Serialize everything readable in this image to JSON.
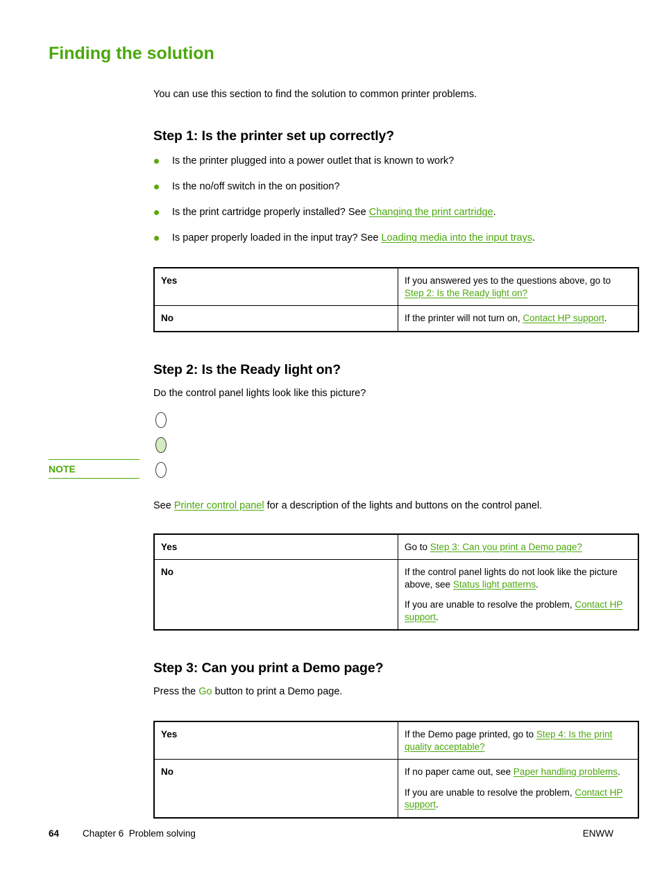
{
  "document": {
    "title": "Finding the solution",
    "intro": "You can use this section to find the solution to common printer problems."
  },
  "step1": {
    "heading": "Step 1: Is the printer set up correctly?",
    "bullets": [
      {
        "text_before": "Is the printer plugged into a power outlet that is known to work?",
        "link": "",
        "text_after": ""
      },
      {
        "text_before": "Is the no/off switch in the on position?",
        "link": "",
        "text_after": ""
      },
      {
        "text_before": "Is the print cartridge properly installed? See ",
        "link": "Changing the print cartridge",
        "text_after": "."
      },
      {
        "text_before": "Is paper properly loaded in the input tray? See ",
        "link": "Loading media into the input trays",
        "text_after": "."
      }
    ],
    "table": {
      "yes_label": "Yes",
      "no_label": "No",
      "yes_text_before": "If you answered yes to the questions above, go to ",
      "yes_link": "Step 2: Is the Ready light on?",
      "yes_text_after": "",
      "no_text_before": "If the printer will not turn on, ",
      "no_link": "Contact HP support",
      "no_text_after": "."
    }
  },
  "step2": {
    "heading": "Step 2: Is the Ready light on?",
    "question": "Do the control panel lights look like this picture?",
    "lights": [
      {
        "name": "attention-light",
        "state": "off"
      },
      {
        "name": "ready-light",
        "state": "on"
      },
      {
        "name": "go-light",
        "state": "off"
      }
    ],
    "note": {
      "label": "NOTE",
      "text_before": "See ",
      "link": "Printer control panel",
      "text_after": " for a description of the lights and buttons on the control panel."
    },
    "table": {
      "yes_label": "Yes",
      "no_label": "No",
      "yes_text_before": "Go to ",
      "yes_link": "Step 3: Can you print a Demo page?",
      "yes_text_after": "",
      "no_p1_before": "If the control panel lights do not look like the picture above, see ",
      "no_p1_link": "Status light patterns",
      "no_p1_after": ".",
      "no_p2_before": "If you are unable to resolve the problem, ",
      "no_p2_link": "Contact HP support",
      "no_p2_after": "."
    }
  },
  "step3": {
    "heading": "Step 3: Can you print a Demo page?",
    "instruction_before": "Press the ",
    "instruction_button": "Go",
    "instruction_after": " button to print a Demo page.",
    "table": {
      "yes_label": "Yes",
      "no_label": "No",
      "yes_text_before": "If the Demo page printed, go to ",
      "yes_link": "Step 4: Is the print quality acceptable?",
      "yes_text_after": "",
      "no_p1_before": "If no paper came out, see ",
      "no_p1_link": "Paper handling problems",
      "no_p1_after": ".",
      "no_p2_before": "If you are unable to resolve the problem, ",
      "no_p2_link": "Contact HP support",
      "no_p2_after": "."
    }
  },
  "footer": {
    "page_number": "64",
    "chapter": "Chapter 6  Problem solving",
    "locale": "ENWW"
  },
  "colors": {
    "title_green": "#4aa80b",
    "link_green": "#4aa80b",
    "bullet_green": "#5ba80b",
    "light_on_fill": "#d3ecc2"
  }
}
